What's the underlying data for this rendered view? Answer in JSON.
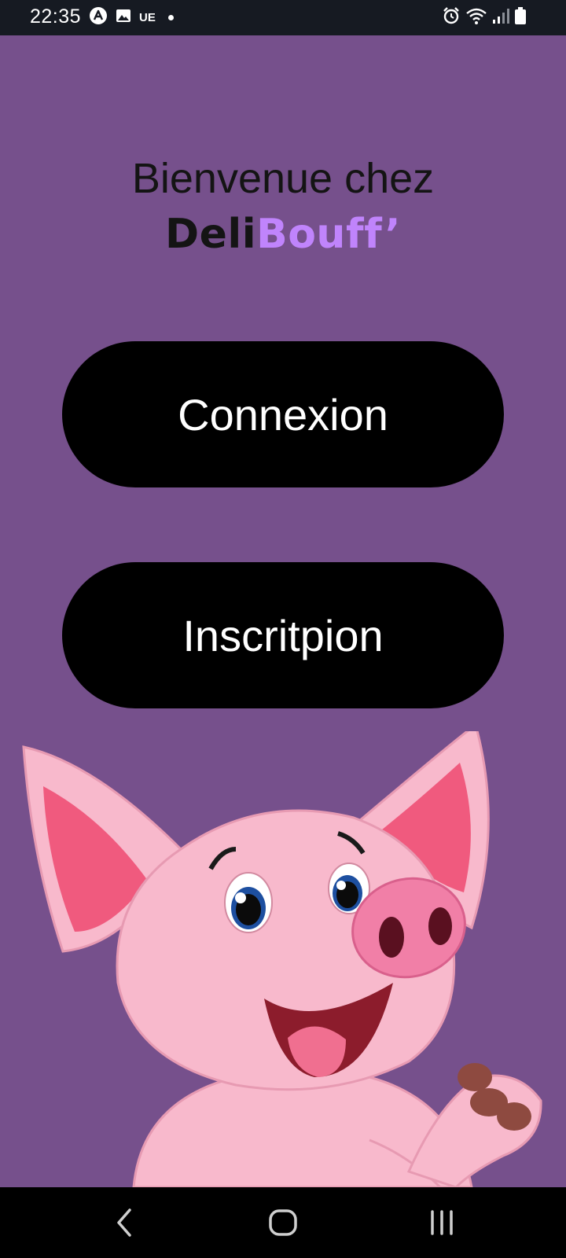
{
  "status_bar": {
    "time": "22:35",
    "carrier_text": "UE",
    "icons": [
      "app-a-icon",
      "gallery-icon",
      "notification-dot-icon",
      "alarm-icon",
      "wifi-icon",
      "signal-icon",
      "battery-icon"
    ]
  },
  "welcome": {
    "title": "Bienvenue chez",
    "brand_part1": "Deli",
    "brand_part2": "Bouff’"
  },
  "buttons": {
    "login_label": "Connexion",
    "signup_label": "Inscritpion"
  },
  "mascot": {
    "icon": "pig-mascot"
  },
  "nav_bar": {
    "icons": [
      "back-icon",
      "home-icon",
      "recent-apps-icon"
    ]
  },
  "colors": {
    "background": "#76508c",
    "button": "#000000",
    "button_text": "#ffffff",
    "brand_accent": "#c084fc",
    "status_bar": "#161a22"
  }
}
